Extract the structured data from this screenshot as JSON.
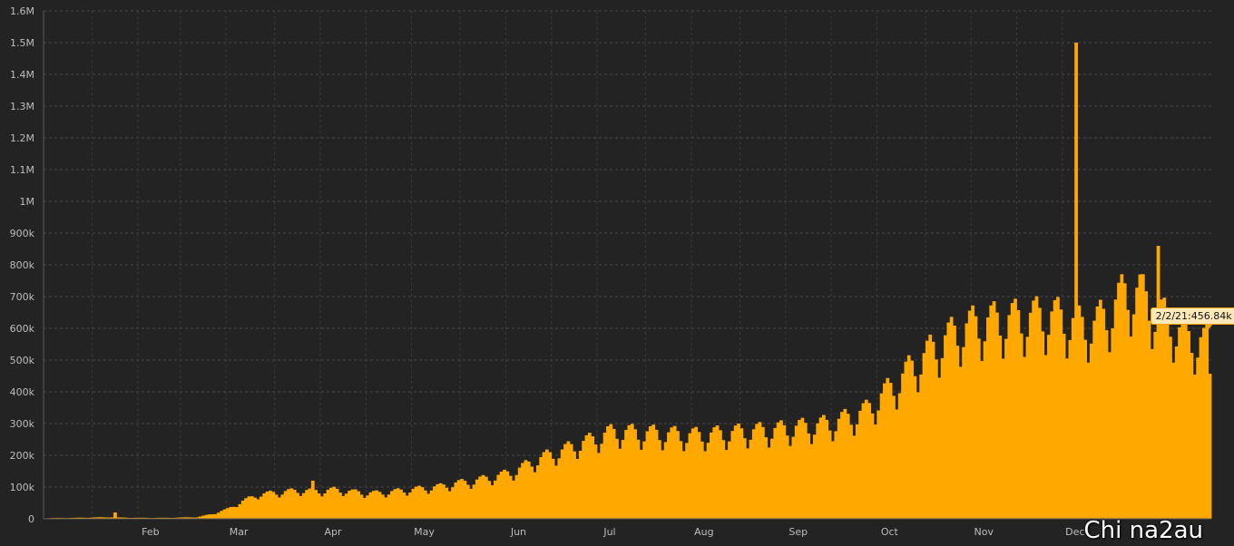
{
  "chart_data": {
    "type": "bar",
    "title": "",
    "xlabel": "",
    "ylabel": "",
    "ylim": [
      0,
      1600000
    ],
    "grid": true,
    "bar_color": "#ffa800",
    "background": "#232323",
    "grid_color": "#4a4a4a",
    "y_ticks": [
      {
        "value": 0,
        "label": "0"
      },
      {
        "value": 100000,
        "label": "100k"
      },
      {
        "value": 200000,
        "label": "200k"
      },
      {
        "value": 300000,
        "label": "300k"
      },
      {
        "value": 400000,
        "label": "400k"
      },
      {
        "value": 500000,
        "label": "500k"
      },
      {
        "value": 600000,
        "label": "600k"
      },
      {
        "value": 700000,
        "label": "700k"
      },
      {
        "value": 800000,
        "label": "800k"
      },
      {
        "value": 900000,
        "label": "900k"
      },
      {
        "value": 1000000,
        "label": "1M"
      },
      {
        "value": 1100000,
        "label": "1.1M"
      },
      {
        "value": 1200000,
        "label": "1.2M"
      },
      {
        "value": 1300000,
        "label": "1.3M"
      },
      {
        "value": 1400000,
        "label": "1.4M"
      },
      {
        "value": 1500000,
        "label": "1.5M"
      },
      {
        "value": 1600000,
        "label": "1.6M"
      }
    ],
    "x_ticks": [
      {
        "label": "Feb",
        "day": 31
      },
      {
        "label": "Mar",
        "day": 60
      },
      {
        "label": "Apr",
        "day": 91
      },
      {
        "label": "May",
        "day": 121
      },
      {
        "label": "Jun",
        "day": 152
      },
      {
        "label": "Jul",
        "day": 182
      },
      {
        "label": "Aug",
        "day": 213
      },
      {
        "label": "Sep",
        "day": 244
      },
      {
        "label": "Oct",
        "day": 274
      },
      {
        "label": "Nov",
        "day": 305
      },
      {
        "label": "Dec",
        "day": 335
      }
    ],
    "series": [
      {
        "keypoints": [
          [
            0,
            2000
          ],
          [
            10,
            3000
          ],
          [
            22,
            5000
          ],
          [
            23,
            15000
          ],
          [
            24,
            4000
          ],
          [
            30,
            3000
          ],
          [
            40,
            3000
          ],
          [
            50,
            5000
          ],
          [
            55,
            15000
          ],
          [
            60,
            30000
          ],
          [
            65,
            55000
          ],
          [
            70,
            75000
          ],
          [
            75,
            80000
          ],
          [
            80,
            85000
          ],
          [
            85,
            88000
          ],
          [
            90,
            85000
          ],
          [
            95,
            90000
          ],
          [
            100,
            85000
          ],
          [
            105,
            80000
          ],
          [
            110,
            80000
          ],
          [
            115,
            85000
          ],
          [
            120,
            90000
          ],
          [
            125,
            95000
          ],
          [
            130,
            100000
          ],
          [
            135,
            110000
          ],
          [
            140,
            115000
          ],
          [
            145,
            125000
          ],
          [
            150,
            135000
          ],
          [
            155,
            150000
          ],
          [
            160,
            175000
          ],
          [
            165,
            195000
          ],
          [
            170,
            210000
          ],
          [
            175,
            230000
          ],
          [
            180,
            245000
          ],
          [
            185,
            265000
          ],
          [
            190,
            270000
          ],
          [
            195,
            265000
          ],
          [
            200,
            265000
          ],
          [
            205,
            262000
          ],
          [
            210,
            260000
          ],
          [
            215,
            258000
          ],
          [
            220,
            262000
          ],
          [
            225,
            265000
          ],
          [
            230,
            270000
          ],
          [
            235,
            272000
          ],
          [
            240,
            275000
          ],
          [
            245,
            280000
          ],
          [
            250,
            285000
          ],
          [
            255,
            290000
          ],
          [
            260,
            300000
          ],
          [
            265,
            315000
          ],
          [
            270,
            335000
          ],
          [
            275,
            380000
          ],
          [
            280,
            420000
          ],
          [
            285,
            470000
          ],
          [
            290,
            510000
          ],
          [
            295,
            550000
          ],
          [
            300,
            580000
          ],
          [
            305,
            600000
          ],
          [
            310,
            610000
          ],
          [
            315,
            615000
          ],
          [
            320,
            620000
          ],
          [
            325,
            625000
          ],
          [
            330,
            630000
          ],
          [
            335,
            620000
          ],
          [
            340,
            600000
          ],
          [
            345,
            600000
          ],
          [
            350,
            640000
          ],
          [
            355,
            700000
          ],
          [
            360,
            700000
          ],
          [
            365,
            640000
          ],
          [
            370,
            610000
          ],
          [
            375,
            560000
          ],
          [
            380,
            550000
          ],
          [
            383,
            540000
          ]
        ],
        "spikes": [
          {
            "day": 23,
            "value": 20000
          },
          {
            "day": 88,
            "value": 120000
          },
          {
            "day": 339,
            "value": 1500000
          },
          {
            "day": 366,
            "value": 860000
          }
        ],
        "last_value": 456840
      }
    ],
    "annotations": [
      {
        "text": "2/2/21:456.84k",
        "day": 383,
        "value": 456840
      }
    ]
  },
  "watermark": "Chi na2au"
}
